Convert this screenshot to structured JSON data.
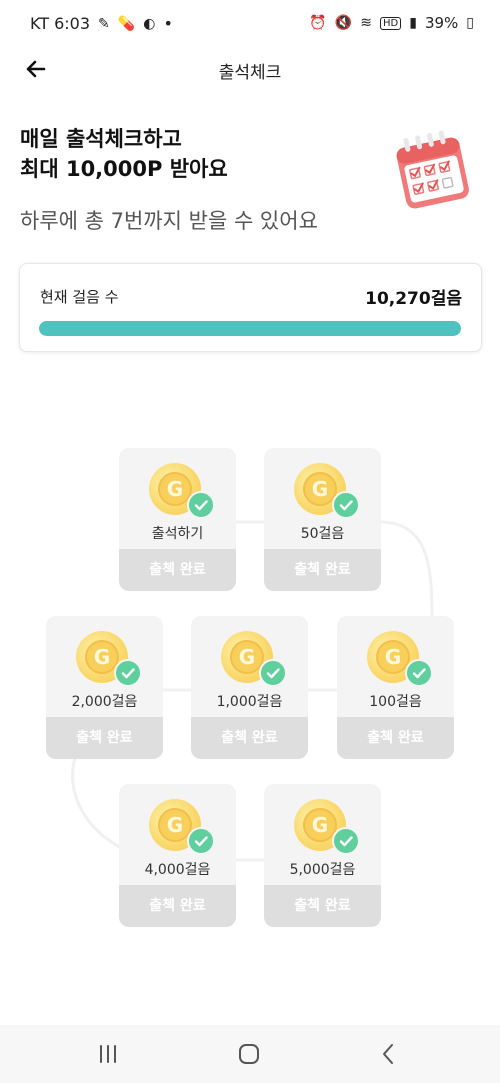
{
  "status_bar": {
    "carrier_time": "KT 6:03",
    "dot": "•",
    "hd": "HD",
    "battery": "39%"
  },
  "app_bar": {
    "title": "출석체크",
    "back_icon": "arrow-left-icon"
  },
  "hero": {
    "title_line1": "매일 출석체크하고",
    "title_line2": "최대 10,000P 받아요",
    "subtitle": "하루에 총 7번까지 받을 수 있어요",
    "image": "calendar-icon"
  },
  "steps_card": {
    "label": "현재 걸음 수",
    "value": "10,270걸음",
    "progress_fraction": 1.0,
    "progress_color": "#4fc2c0"
  },
  "stamps": [
    {
      "label": "출석하기",
      "button": "출첵 완료",
      "coin": "G",
      "checked": true
    },
    {
      "label": "50걸음",
      "button": "출첵 완료",
      "coin": "G",
      "checked": true
    },
    {
      "label": "100걸음",
      "button": "출첵 완료",
      "coin": "G",
      "checked": true
    },
    {
      "label": "1,000걸음",
      "button": "출첵 완료",
      "coin": "G",
      "checked": true
    },
    {
      "label": "2,000걸음",
      "button": "출첵 완료",
      "coin": "G",
      "checked": true
    },
    {
      "label": "4,000걸음",
      "button": "출첵 완료",
      "coin": "G",
      "checked": true
    },
    {
      "label": "5,000걸음",
      "button": "출첵 완료",
      "coin": "G",
      "checked": true
    }
  ],
  "nav_bar": {
    "recents_icon": "recents-icon",
    "home_icon": "home-icon",
    "back_icon": "back-chevron-icon"
  },
  "colors": {
    "accent": "#4fc2c0",
    "check": "#5fcf9d",
    "coin": "#f8cf5a",
    "completed_button": "#dedede"
  }
}
